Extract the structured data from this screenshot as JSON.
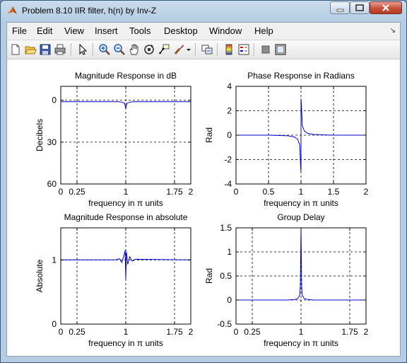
{
  "window": {
    "title": "Problem 8.10 IIR filter, h(n) by Inv-Z",
    "controls": [
      "minimize-icon",
      "maximize-icon",
      "close-icon"
    ]
  },
  "menubar": {
    "items": [
      "File",
      "Edit",
      "View",
      "Insert",
      "Tools",
      "Desktop",
      "Window",
      "Help"
    ],
    "dock_icon": "dock-arrow-icon"
  },
  "toolbar": {
    "buttons": [
      "new-figure-icon",
      "open-file-icon",
      "save-icon",
      "print-icon",
      "edit-plot-arrow-icon",
      "zoom-in-icon",
      "zoom-out-icon",
      "pan-hand-icon",
      "rotate-3d-icon",
      "data-cursor-icon",
      "brush-icon",
      "brush-dropdown-icon",
      "link-plot-icon",
      "colorbar-icon",
      "legend-icon",
      "hide-plot-tools-icon",
      "show-plot-tools-icon"
    ]
  },
  "colors": {
    "line": "#0000cc",
    "grid": "#000000",
    "axes_bg": "#ffffff",
    "figure_bg": "#ffffff"
  },
  "chart_data": [
    {
      "type": "line",
      "title": "Magnitude Response in dB",
      "xlabel": "frequency in π units",
      "ylabel": "Decibels",
      "xlim": [
        0,
        2
      ],
      "ylim": [
        60,
        -10
      ],
      "x_ticks": [
        0,
        0.25,
        1,
        1.75,
        2
      ],
      "x_tick_labels": [
        "0",
        "0.25",
        "1",
        "1.75",
        "2"
      ],
      "y_ticks": [
        0,
        30,
        60
      ],
      "y_tick_labels": [
        "0",
        "30",
        "60"
      ],
      "y_reversed": true,
      "grid": true,
      "series": [
        {
          "x": [
            0,
            0.9,
            0.98,
            1.0,
            1.02,
            1.1,
            2
          ],
          "values": [
            1,
            1,
            2,
            6,
            2,
            1,
            1
          ]
        }
      ]
    },
    {
      "type": "line",
      "title": "Phase Response in Radians",
      "xlabel": "frequency in π units",
      "ylabel": "Rad",
      "xlim": [
        0,
        2
      ],
      "ylim": [
        -4,
        4
      ],
      "x_ticks": [
        0,
        0.5,
        1,
        1.5,
        2
      ],
      "x_tick_labels": [
        "0",
        "0.5",
        "1",
        "1.5",
        "2"
      ],
      "y_ticks": [
        -4,
        -2,
        0,
        2,
        4
      ],
      "y_tick_labels": [
        "-4",
        "-2",
        "0",
        "2",
        "4"
      ],
      "grid": true,
      "series": [
        {
          "x": [
            0,
            0.5,
            0.8,
            0.9,
            0.95,
            0.98,
            0.995,
            1.0,
            1.0,
            1.005,
            1.02,
            1.05,
            1.1,
            1.2,
            1.5,
            2
          ],
          "values": [
            0,
            0,
            -0.05,
            -0.15,
            -0.35,
            -0.8,
            -2.6,
            -3.0,
            3.0,
            2.6,
            0.8,
            0.35,
            0.15,
            0.05,
            0,
            0
          ]
        }
      ]
    },
    {
      "type": "line",
      "title": "Magnitude Response in absolute",
      "xlabel": "frequency in π units",
      "ylabel": "Absolute",
      "xlim": [
        0,
        2
      ],
      "ylim": [
        0,
        1.5
      ],
      "x_ticks": [
        0,
        0.25,
        1,
        1.75,
        2
      ],
      "x_tick_labels": [
        "0",
        "0.25",
        "1",
        "1.75",
        "2"
      ],
      "y_ticks": [
        0,
        1
      ],
      "y_tick_labels": [
        "0",
        "1"
      ],
      "grid": true,
      "series": [
        {
          "x": [
            0,
            0.85,
            0.9,
            0.94,
            0.97,
            0.99,
            1.0,
            1.01,
            1.03,
            1.06,
            1.1,
            1.15,
            2
          ],
          "values": [
            1,
            1,
            1.02,
            0.96,
            1.06,
            1.15,
            0.7,
            1.13,
            0.93,
            1.05,
            0.98,
            1.01,
            1
          ]
        }
      ]
    },
    {
      "type": "line",
      "title": "Group Delay",
      "xlabel": "frequency in π units",
      "ylabel": "Rad",
      "xlim": [
        0,
        2
      ],
      "ylim": [
        -0.5,
        1.5
      ],
      "x_ticks": [
        0,
        0.25,
        1,
        1.75,
        2
      ],
      "x_tick_labels": [
        "0",
        "0.25",
        "1",
        "1.75",
        "2"
      ],
      "y_ticks": [
        -0.5,
        0,
        0.5,
        1,
        1.5
      ],
      "y_tick_labels": [
        "-0.5",
        "0",
        "0.5",
        "1",
        "1.5"
      ],
      "grid": true,
      "series": [
        {
          "x": [
            0,
            0.8,
            0.9,
            0.95,
            0.98,
            0.99,
            1.0,
            1.01,
            1.02,
            1.05,
            1.1,
            1.2,
            2
          ],
          "values": [
            0,
            0,
            0.01,
            0.03,
            0.1,
            0.3,
            1.5,
            0.3,
            0.1,
            0.03,
            0.01,
            0,
            0
          ]
        }
      ]
    }
  ]
}
